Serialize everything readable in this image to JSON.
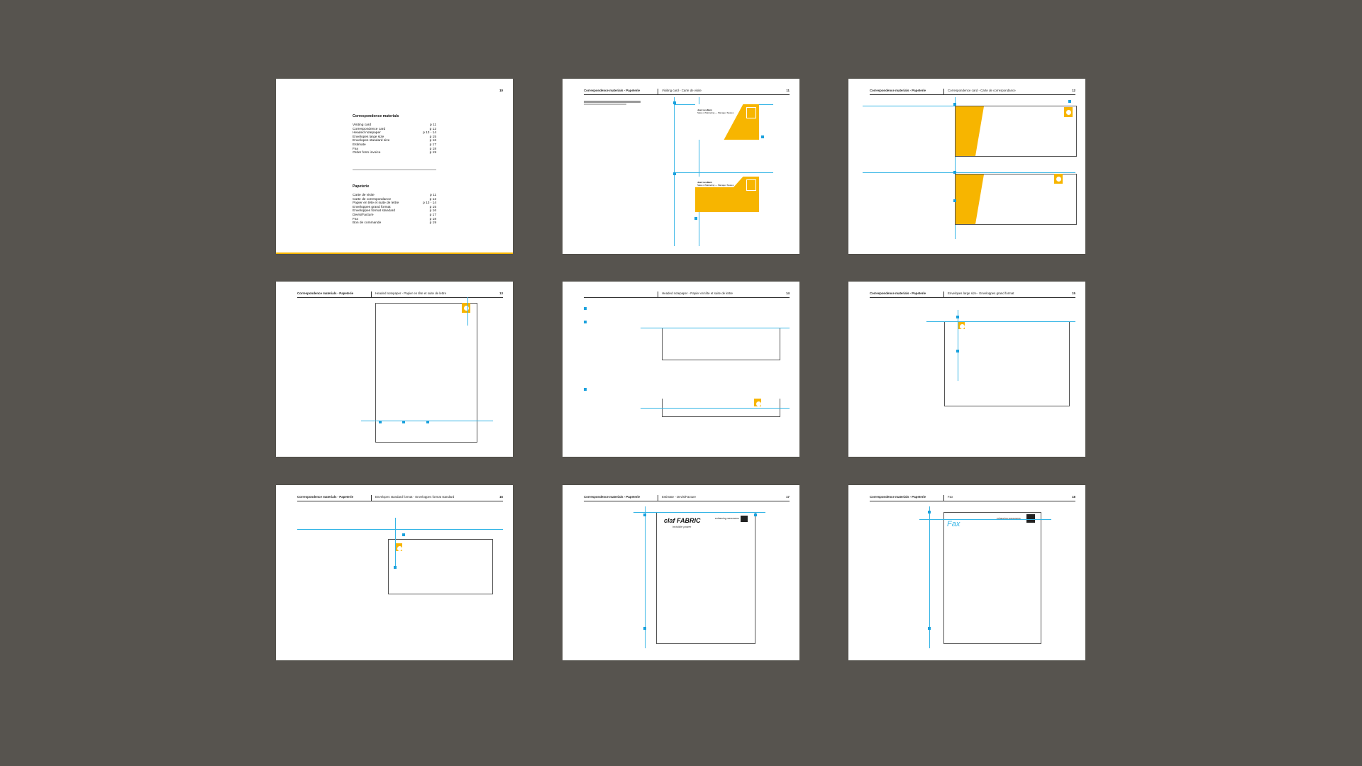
{
  "pages": {
    "p10": {
      "number": "10",
      "toc_en_title": "Correspondence materials",
      "toc_en": [
        {
          "label": "Visiting card",
          "page": "p 11"
        },
        {
          "label": "Correspondence card",
          "page": "p 12"
        },
        {
          "label": "Headed notepaper",
          "page": "p 13 - 14"
        },
        {
          "label": "Envelopes large size",
          "page": "p 15"
        },
        {
          "label": "Envelopes standard size",
          "page": "p 16"
        },
        {
          "label": "Estimate",
          "page": "p 17"
        },
        {
          "label": "Fax",
          "page": "p 18"
        },
        {
          "label": "Order form invoice",
          "page": "p 19"
        }
      ],
      "toc_fr_title": "Papeterie",
      "toc_fr": [
        {
          "label": "Carte de visite",
          "page": "p 11"
        },
        {
          "label": "Carte de correspondance",
          "page": "p 12"
        },
        {
          "label": "Papier en tête et suite de lettre",
          "page": "p 13 - 14"
        },
        {
          "label": "Enveloppes grand format",
          "page": "p 15"
        },
        {
          "label": "Enveloppes format standard",
          "page": "p 16"
        },
        {
          "label": "Devis/Facture",
          "page": "p 17"
        },
        {
          "label": "Fax",
          "page": "p 18"
        },
        {
          "label": "Bon de commande",
          "page": "p 19"
        }
      ]
    },
    "p11": {
      "section": "Correspondence materials - Papeterie",
      "title": "Visiting card - Carte de visite",
      "number": "11",
      "card_name": "Jean Lesdkam",
      "card_role": "Sales & Marketing — Manager Spares"
    },
    "p12": {
      "section": "Correspondence materials - Papeterie",
      "title": "Correspondence card - Carte de correspondance",
      "number": "12"
    },
    "p13": {
      "section": "Correspondence materials - Papeterie",
      "title": "Headed notepaper - Papier en tête et suite de lettre",
      "number": "13"
    },
    "p14": {
      "section": "",
      "title": "Headed notepaper - Papier en tête et suite de lettre",
      "number": "14"
    },
    "p15": {
      "section": "Correspondence materials - Papeterie",
      "title": "Envelopes large size - Enveloppes grand format",
      "number": "15"
    },
    "p16": {
      "section": "Correspondence materials - Papeterie",
      "title": "Envelopes standard format - Enveloppes format standard",
      "number": "16"
    },
    "p17": {
      "section": "Correspondence materials - Papeterie",
      "title": "Estimate - Devis/Facture",
      "number": "17",
      "logo": "claf FABRIC",
      "logo_sub": "invisible power",
      "tagline": "enhancing nonwovens"
    },
    "p18": {
      "section": "Correspondence materials - Papeterie",
      "title": "Fax",
      "number": "18",
      "fax_word": "Fax",
      "tagline": "enhancing nonwovens"
    }
  },
  "colors": {
    "background": "#57544f",
    "brand_yellow": "#f7b500",
    "guide_blue": "#35b5e6"
  }
}
